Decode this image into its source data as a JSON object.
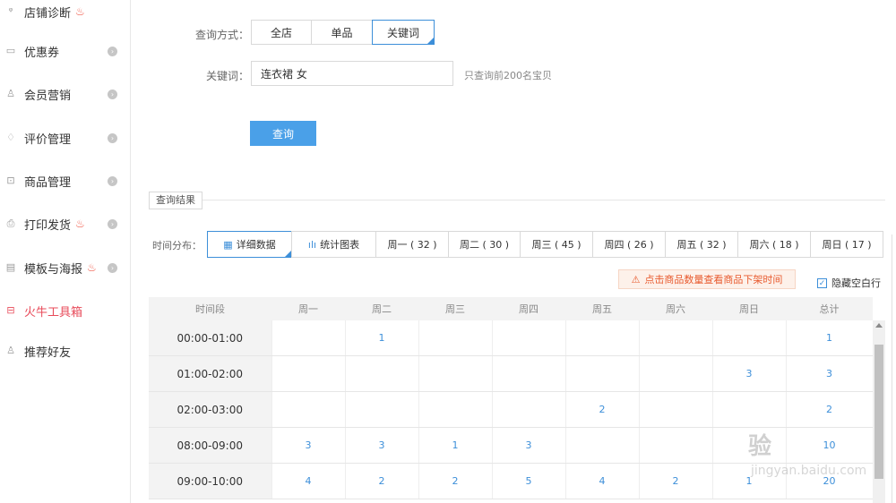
{
  "sidebar": {
    "items": [
      {
        "label": "店铺诊断",
        "icon": "stethoscope-icon",
        "flame": true,
        "chevron": false
      },
      {
        "label": "优惠券",
        "icon": "coupon-icon",
        "flame": false,
        "chevron": true
      },
      {
        "label": "会员营销",
        "icon": "user-icon",
        "flame": false,
        "chevron": true
      },
      {
        "label": "评价管理",
        "icon": "review-icon",
        "flame": false,
        "chevron": true
      },
      {
        "label": "商品管理",
        "icon": "product-icon",
        "flame": false,
        "chevron": true
      },
      {
        "label": "打印发货",
        "icon": "printer-icon",
        "flame": true,
        "chevron": true
      },
      {
        "label": "模板与海报",
        "icon": "template-icon",
        "flame": true,
        "chevron": true
      },
      {
        "label": "火牛工具箱",
        "icon": "toolbox-icon",
        "flame": false,
        "chevron": false,
        "active": true
      },
      {
        "label": "推荐好友",
        "icon": "friend-icon",
        "flame": false,
        "chevron": false
      }
    ]
  },
  "form": {
    "mode_label": "查询方式：",
    "modes": [
      "全店",
      "单品",
      "关键词"
    ],
    "selected_mode": "关键词",
    "keyword_label": "关键词：",
    "keyword_value": "连衣裙 女",
    "hint": "只查询前200名宝贝",
    "query_button": "查询"
  },
  "results": {
    "section_title": "查询结果",
    "time_dist_label": "时间分布：",
    "tabs": [
      {
        "label": "详细数据",
        "icon": "table-icon",
        "selected": true
      },
      {
        "label": "统计图表",
        "icon": "bar-chart-icon",
        "selected": false
      },
      {
        "label": "周一 ( 32 )"
      },
      {
        "label": "周二 ( 30 )"
      },
      {
        "label": "周三 ( 45 )"
      },
      {
        "label": "周四 ( 26 )"
      },
      {
        "label": "周五 ( 32 )"
      },
      {
        "label": "周六 ( 18 )"
      },
      {
        "label": "周日 ( 17 )"
      }
    ],
    "warning": "点击商品数量查看商品下架时间",
    "hide_empty_label": "隐藏空白行",
    "hide_empty_checked": true
  },
  "table": {
    "headers": [
      "时间段",
      "周一",
      "周二",
      "周三",
      "周四",
      "周五",
      "周六",
      "周日",
      "总计"
    ],
    "rows": [
      [
        "00:00-01:00",
        "",
        "1",
        "",
        "",
        "",
        "",
        "",
        "1"
      ],
      [
        "01:00-02:00",
        "",
        "",
        "",
        "",
        "",
        "",
        "3",
        "3"
      ],
      [
        "02:00-03:00",
        "",
        "",
        "",
        "",
        "2",
        "",
        "",
        "2"
      ],
      [
        "08:00-09:00",
        "3",
        "3",
        "1",
        "3",
        "",
        "",
        "",
        "10"
      ],
      [
        "09:00-10:00",
        "4",
        "2",
        "2",
        "5",
        "4",
        "2",
        "1",
        "20"
      ]
    ]
  },
  "watermark": {
    "text": "验",
    "sub": "jingyan.baidu.com"
  }
}
